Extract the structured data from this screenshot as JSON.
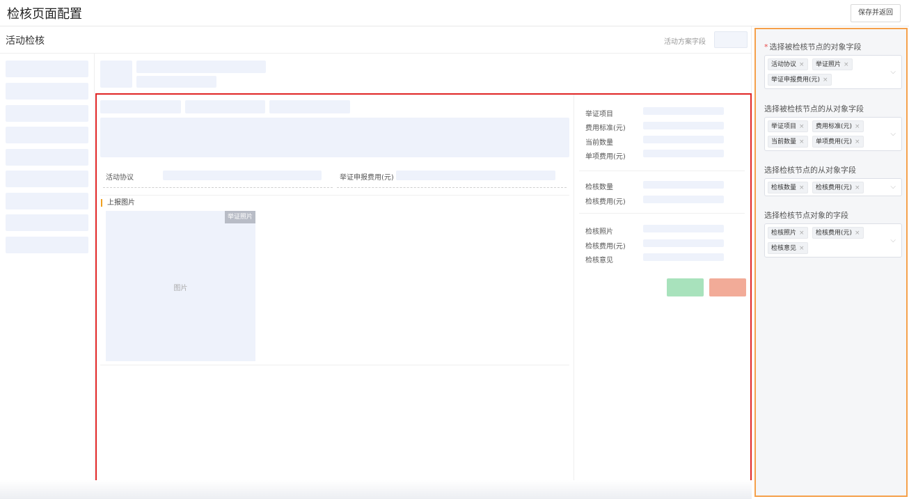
{
  "header": {
    "title": "检核页面配置",
    "save_label": "保存并返回"
  },
  "main": {
    "section_title": "活动检核",
    "scheme_field_label": "活动方案字段",
    "form": {
      "activity_agreement_label": "活动协议",
      "proof_fee_label": "举证申报费用(元)",
      "report_photos_title": "上报图片",
      "photo_tag": "举证照片",
      "photo_placeholder": "图片"
    },
    "detail": {
      "group1": [
        "举证项目",
        "费用标准(元)",
        "当前数量",
        "单项费用(元)"
      ],
      "group2": [
        "检核数量",
        "检核费用(元)"
      ],
      "group3": [
        "检核照片",
        "检核费用(元)",
        "检核意见"
      ]
    },
    "colors": {
      "confirm": "#a8e2bc",
      "reject": "#f2ab98",
      "highlight": "#e02525"
    }
  },
  "config_panel": {
    "fields": [
      {
        "label": "选择被检核节点的对象字段",
        "required": true,
        "tags": [
          "活动协议",
          "举证照片",
          "举证申报费用(元)"
        ]
      },
      {
        "label": "选择被检核节点的从对象字段",
        "required": false,
        "tags": [
          "举证项目",
          "费用标准(元)",
          "当前数量",
          "单项费用(元)"
        ]
      },
      {
        "label": "选择检核节点的从对象字段",
        "required": false,
        "tags": [
          "检核数量",
          "检核费用(元)"
        ]
      },
      {
        "label": "选择检核节点对象的字段",
        "required": false,
        "tags": [
          "检核照片",
          "检核费用(元)",
          "检核意见"
        ]
      }
    ],
    "required_mark": "*",
    "remove_glyph": "×",
    "dropdown_glyph": "⌵",
    "accent_color": "#f5a04a"
  }
}
